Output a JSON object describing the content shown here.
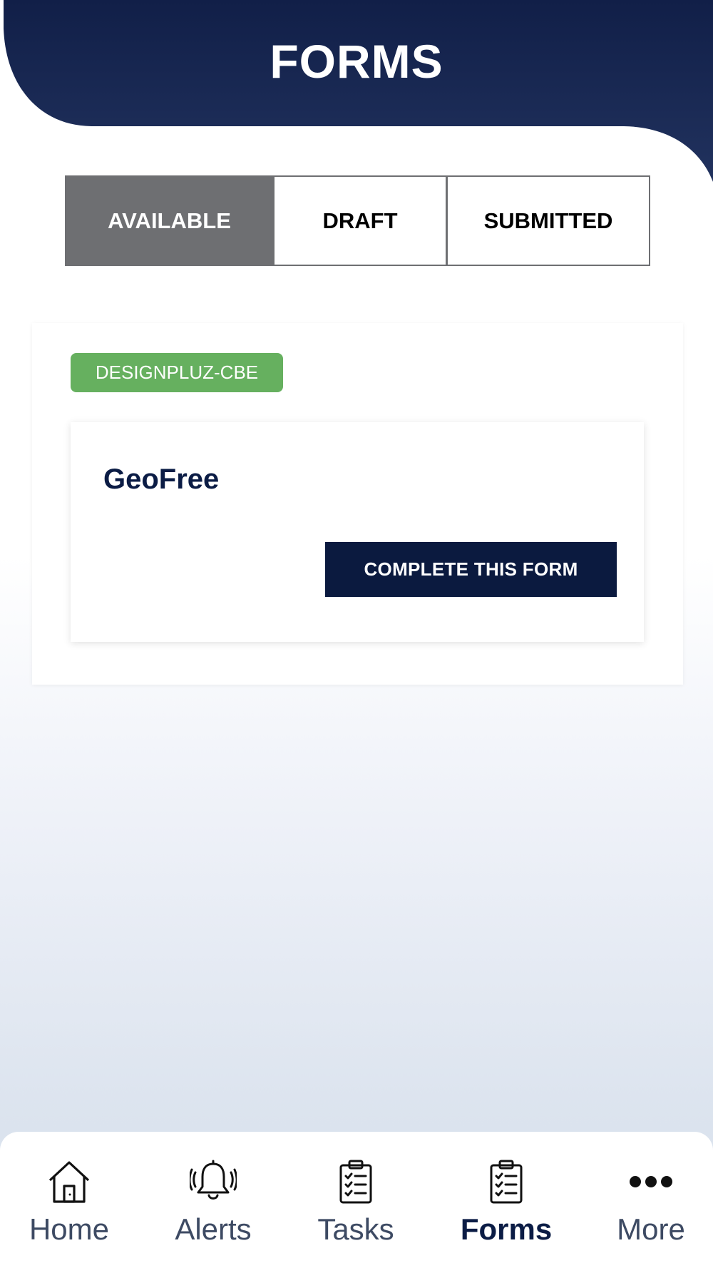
{
  "header": {
    "title": "FORMS",
    "color": "#12224b"
  },
  "tabs": [
    {
      "label": "AVAILABLE",
      "active": true
    },
    {
      "label": "DRAFT",
      "active": false
    },
    {
      "label": "SUBMITTED",
      "active": false
    }
  ],
  "group": {
    "badge": "DESIGNPLUZ-CBE",
    "badge_color": "#66b05f",
    "forms": [
      {
        "title": "GeoFree",
        "action_label": "COMPLETE THIS FORM"
      }
    ]
  },
  "bottom_nav": {
    "items": [
      {
        "label": "Home",
        "icon": "home-icon",
        "active": false
      },
      {
        "label": "Alerts",
        "icon": "bell-icon",
        "active": false
      },
      {
        "label": "Tasks",
        "icon": "clipboard-icon",
        "active": false
      },
      {
        "label": "Forms",
        "icon": "clipboard-icon",
        "active": true
      },
      {
        "label": "More",
        "icon": "more-icon",
        "active": false
      }
    ]
  }
}
